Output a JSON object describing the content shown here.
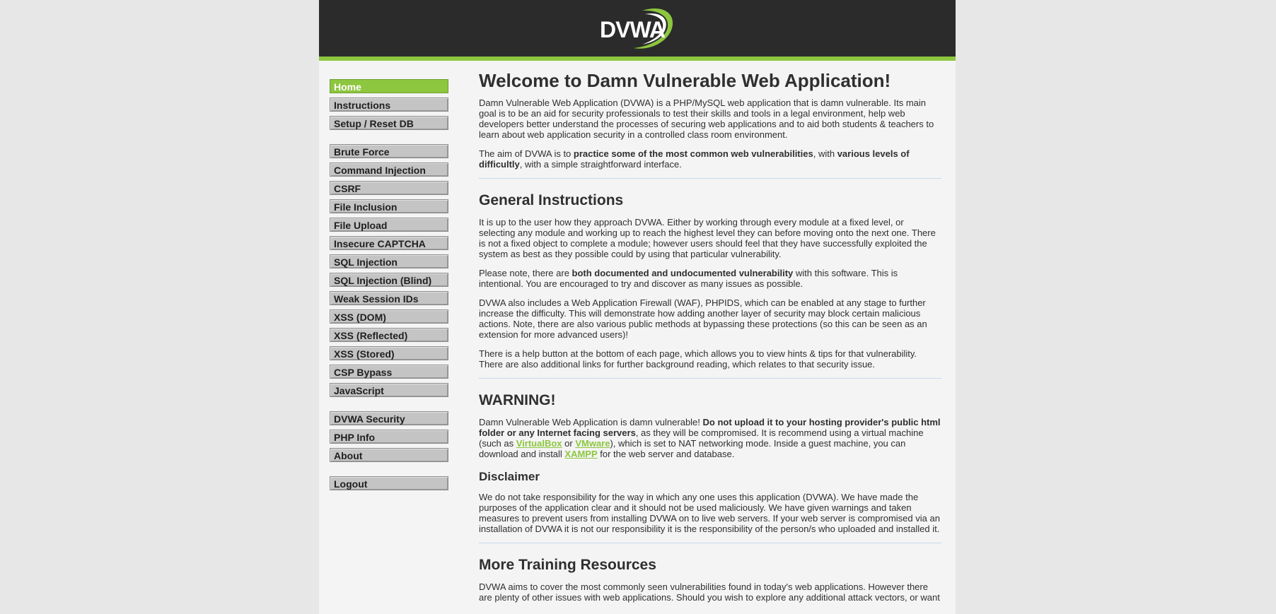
{
  "header": {
    "logo_text": "DVWA"
  },
  "sidebar": {
    "group1": [
      {
        "label": "Home",
        "selected": true
      },
      {
        "label": "Instructions"
      },
      {
        "label": "Setup / Reset DB"
      }
    ],
    "group2": [
      {
        "label": "Brute Force"
      },
      {
        "label": "Command Injection"
      },
      {
        "label": "CSRF"
      },
      {
        "label": "File Inclusion"
      },
      {
        "label": "File Upload"
      },
      {
        "label": "Insecure CAPTCHA"
      },
      {
        "label": "SQL Injection"
      },
      {
        "label": "SQL Injection (Blind)"
      },
      {
        "label": "Weak Session IDs"
      },
      {
        "label": "XSS (DOM)"
      },
      {
        "label": "XSS (Reflected)"
      },
      {
        "label": "XSS (Stored)"
      },
      {
        "label": "CSP Bypass"
      },
      {
        "label": "JavaScript"
      }
    ],
    "group3": [
      {
        "label": "DVWA Security"
      },
      {
        "label": "PHP Info"
      },
      {
        "label": "About"
      }
    ],
    "group4": [
      {
        "label": "Logout"
      }
    ]
  },
  "main": {
    "title": "Welcome to Damn Vulnerable Web Application!",
    "intro": "Damn Vulnerable Web Application (DVWA) is a PHP/MySQL web application that is damn vulnerable. Its main goal is to be an aid for security professionals to test their skills and tools in a legal environment, help web developers better understand the processes of securing web applications and to aid both students & teachers to learn about web application security in a controlled class room environment.",
    "aim": {
      "p1": "The aim of DVWA is to ",
      "b1": "practice some of the most common web vulnerabilities",
      "p2": ", with ",
      "b2": "various levels of difficultly",
      "p3": ", with a simple straightforward interface."
    },
    "general": {
      "heading": "General Instructions",
      "p1": "It is up to the user how they approach DVWA. Either by working through every module at a fixed level, or selecting any module and working up to reach the highest level they can before moving onto the next one. There is not a fixed object to complete a module; however users should feel that they have successfully exploited the system as best as they possible could by using that particular vulnerability.",
      "p2_a": "Please note, there are ",
      "p2_b": "both documented and undocumented vulnerability",
      "p2_c": " with this software. This is intentional. You are encouraged to try and discover as many issues as possible.",
      "p3": "DVWA also includes a Web Application Firewall (WAF), PHPIDS, which can be enabled at any stage to further increase the difficulty. This will demonstrate how adding another layer of security may block certain malicious actions. Note, there are also various public methods at bypassing these protections (so this can be seen as an extension for more advanced users)!",
      "p4": "There is a help button at the bottom of each page, which allows you to view hints & tips for that vulnerability. There are also additional links for further background reading, which relates to that security issue."
    },
    "warning": {
      "heading": "WARNING!",
      "a": "Damn Vulnerable Web Application is damn vulnerable! ",
      "b": "Do not upload it to your hosting provider's public html folder or any Internet facing servers",
      "c": ", as they will be compromised. It is recommend using a virtual machine (such as ",
      "link1": "VirtualBox",
      "d": " or ",
      "link2": "VMware",
      "e": "), which is set to NAT networking mode. Inside a guest machine, you can download and install ",
      "link3": "XAMPP",
      "f": " for the web server and database."
    },
    "disclaimer": {
      "heading": "Disclaimer",
      "text": "We do not take responsibility for the way in which any one uses this application (DVWA). We have made the purposes of the application clear and it should not be used maliciously. We have given warnings and taken measures to prevent users from installing DVWA on to live web servers. If your web server is compromised via an installation of DVWA it is not our responsibility it is the responsibility of the person/s who uploaded and installed it."
    },
    "training": {
      "heading": "More Training Resources",
      "text": "DVWA aims to cover the most commonly seen vulnerabilities found in today's web applications. However there are plenty of other issues with web applications. Should you wish to explore any additional attack vectors, or want"
    }
  }
}
